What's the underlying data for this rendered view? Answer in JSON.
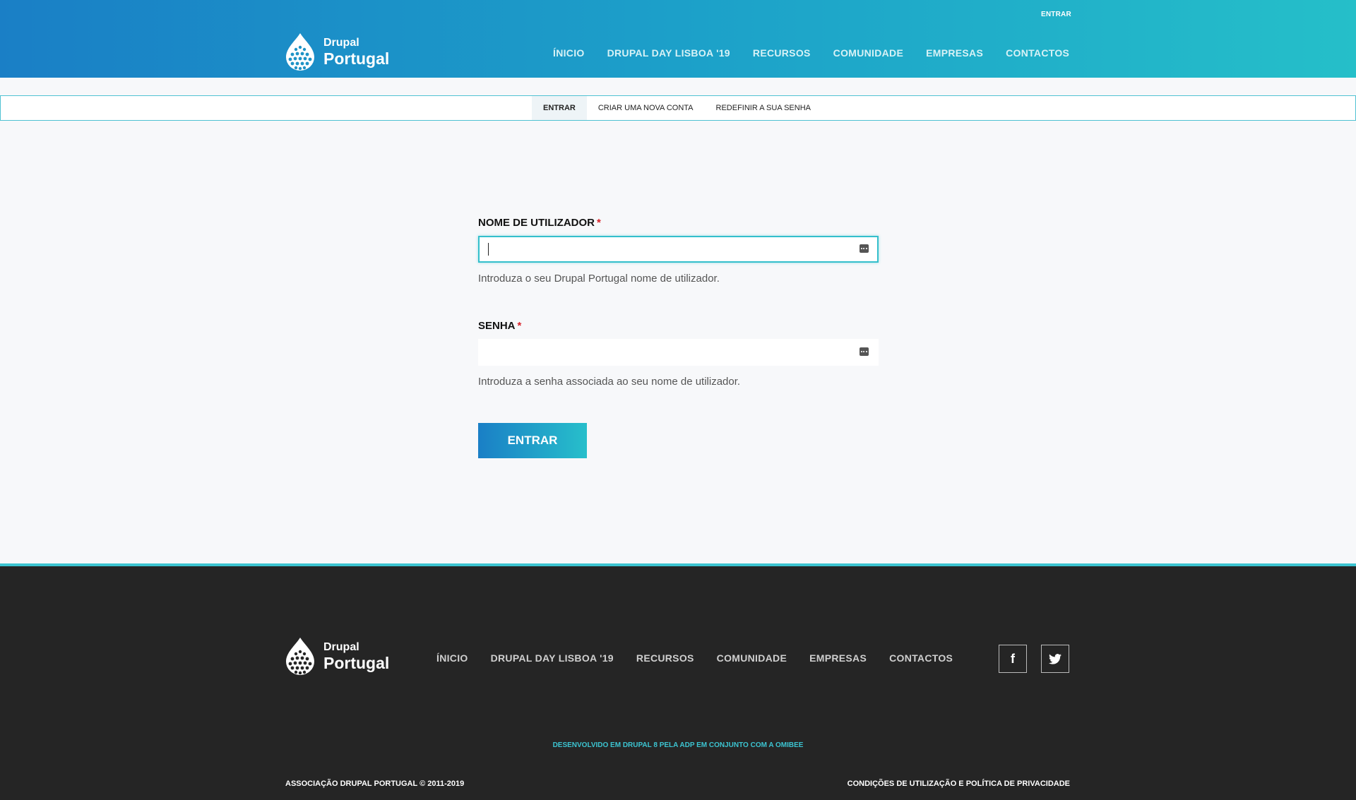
{
  "header": {
    "top_login": "ENTRAR",
    "brand_line1": "Drupal",
    "brand_line2": "Portugal",
    "nav": [
      "ÍNICIO",
      "DRUPAL DAY LISBOA '19",
      "RECURSOS",
      "COMUNIDADE",
      "EMPRESAS",
      "CONTACTOS"
    ]
  },
  "tabs": [
    "ENTRAR",
    "CRIAR UMA NOVA CONTA",
    "REDEFINIR A SUA SENHA"
  ],
  "form": {
    "username_label": "NOME DE UTILIZADOR",
    "required_mark": "*",
    "username_value": "",
    "username_desc": "Introduza o seu Drupal Portugal nome de utilizador.",
    "password_label": "SENHA",
    "password_value": "",
    "password_desc": "Introduza a senha associada ao seu nome de utilizador.",
    "submit_label": "ENTRAR"
  },
  "footer": {
    "brand_line1": "Drupal",
    "brand_line2": "Portugal",
    "nav": [
      "ÍNICIO",
      "DRUPAL DAY LISBOA '19",
      "RECURSOS",
      "COMUNIDADE",
      "EMPRESAS",
      "CONTACTOS"
    ],
    "facebook_glyph": "f",
    "credit": "DESENVOLVIDO EM DRUPAL 8 PELA ADP EM CONJUNTO COM A OMIBEE",
    "copyright": "ASSOCIAÇÃO DRUPAL PORTUGAL © 2011-2019",
    "terms": "CONDIÇÕES DE UTILIZAÇÃO E POLÍTICA DE PRIVACIDADE"
  },
  "colors": {
    "header_gradient_start": "#1a7fc6",
    "header_gradient_end": "#25bfc9",
    "accent": "#3cc4d1",
    "required": "#d8232a",
    "footer_bg": "#252525"
  },
  "icons": [
    "drupal-drop-logo",
    "keyboard-icon",
    "facebook-icon",
    "twitter-icon"
  ]
}
